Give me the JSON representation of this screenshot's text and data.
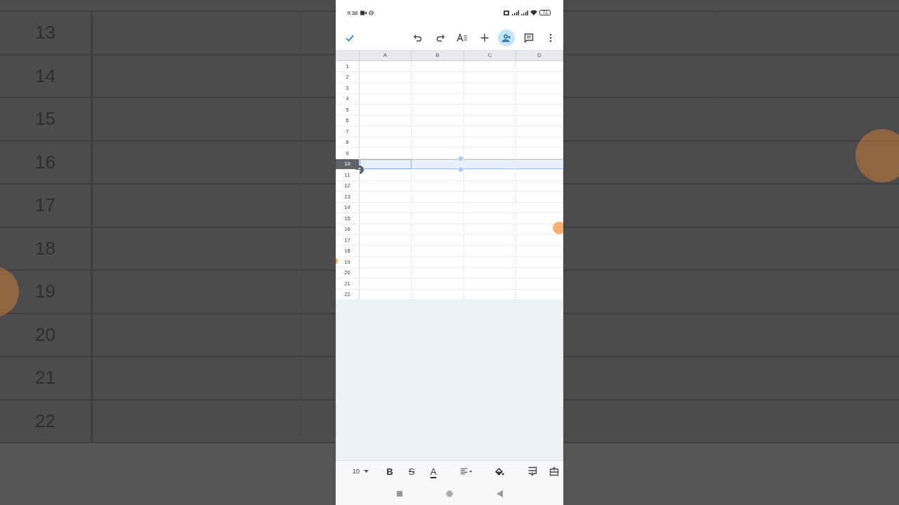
{
  "backdrop": {
    "row_numbers": [
      "13",
      "14",
      "15",
      "16",
      "17",
      "18",
      "19",
      "20",
      "21",
      "22"
    ]
  },
  "status_bar": {
    "time": "9:38",
    "battery": "71"
  },
  "toolbar": [
    {
      "kind": "done",
      "active": false
    },
    {
      "kind": "undo",
      "active": false
    },
    {
      "kind": "redo",
      "active": false
    },
    {
      "kind": "format",
      "active": false
    },
    {
      "kind": "insert",
      "active": false
    },
    {
      "kind": "share",
      "active": true
    },
    {
      "kind": "comment",
      "active": false
    },
    {
      "kind": "more",
      "active": false
    }
  ],
  "sheet": {
    "columns": [
      "A",
      "B",
      "C",
      "D"
    ],
    "rows": [
      {
        "label": "1",
        "selected": false
      },
      {
        "label": "2",
        "selected": false
      },
      {
        "label": "3",
        "selected": false
      },
      {
        "label": "4",
        "selected": false
      },
      {
        "label": "5",
        "selected": false
      },
      {
        "label": "6",
        "selected": false
      },
      {
        "label": "7",
        "selected": false
      },
      {
        "label": "8",
        "selected": false
      },
      {
        "label": "9",
        "selected": false
      },
      {
        "label": "10",
        "selected": true
      },
      {
        "label": "11",
        "selected": false
      },
      {
        "label": "12",
        "selected": false
      },
      {
        "label": "13",
        "selected": false
      },
      {
        "label": "14",
        "selected": false
      },
      {
        "label": "15",
        "selected": false
      },
      {
        "label": "16",
        "selected": false
      },
      {
        "label": "17",
        "selected": false
      },
      {
        "label": "18",
        "selected": false
      },
      {
        "label": "19",
        "selected": false
      },
      {
        "label": "20",
        "selected": false
      },
      {
        "label": "21",
        "selected": false
      },
      {
        "label": "22",
        "selected": false
      }
    ]
  },
  "format_bar": {
    "font_size": "10",
    "bold": "B",
    "strikethrough": "S",
    "text_color": "A"
  }
}
